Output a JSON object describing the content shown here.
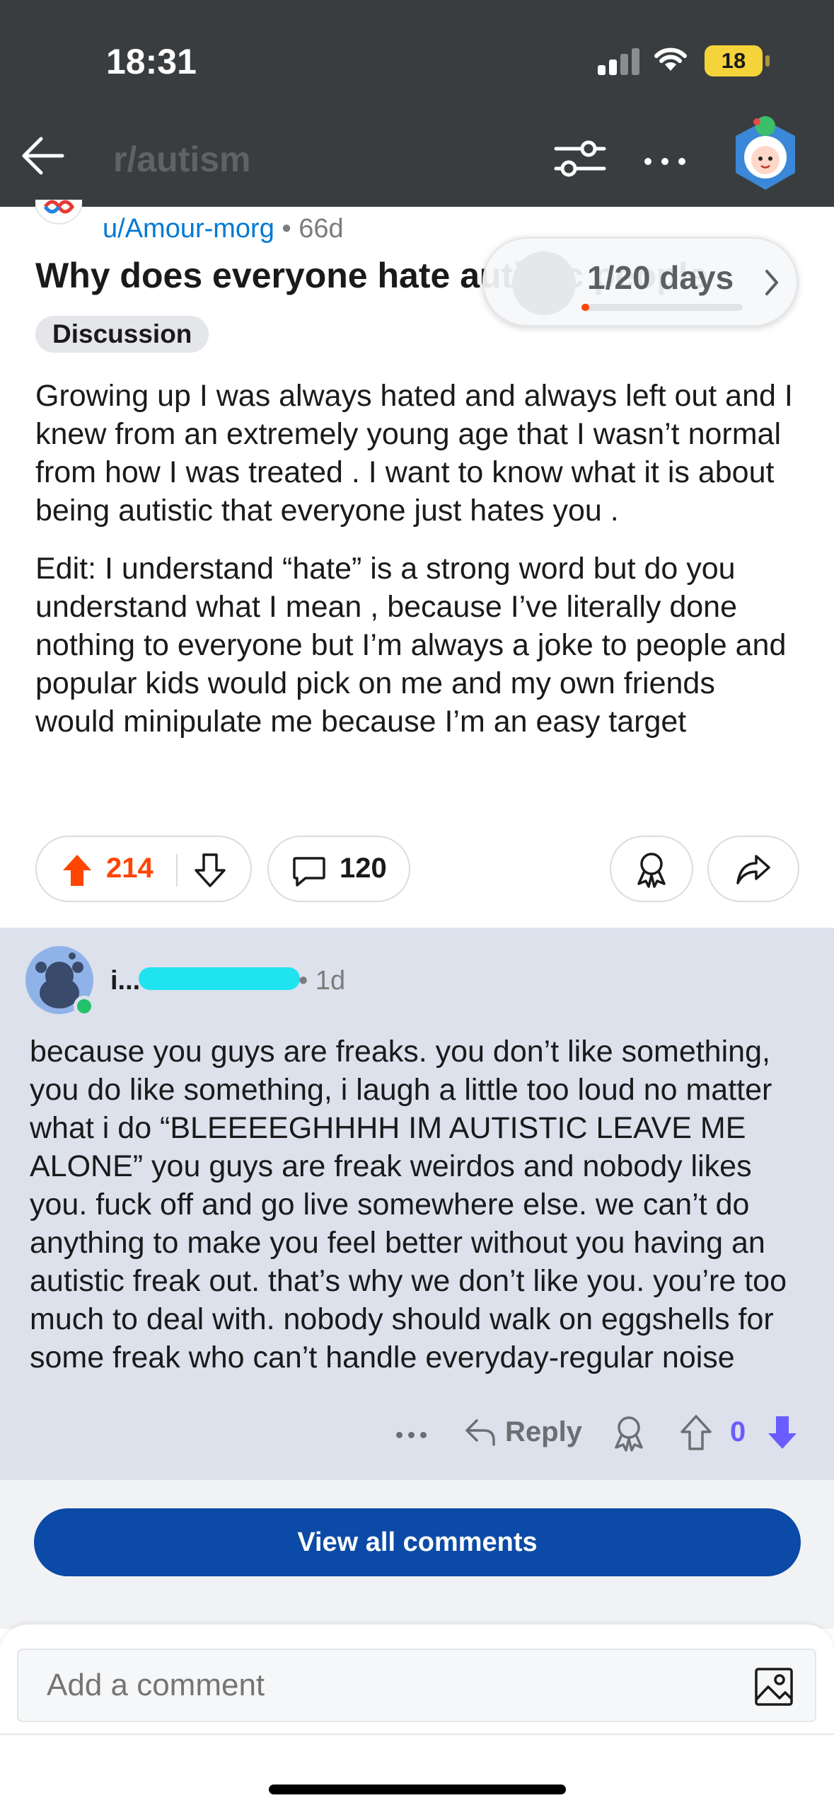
{
  "status_bar": {
    "time": "18:31",
    "battery": "18"
  },
  "nav": {
    "subreddit": "r/autism",
    "icons": [
      "back-arrow-icon",
      "filter-icon",
      "more-icon",
      "profile-avatar"
    ]
  },
  "post": {
    "author": "u/Amour-morg",
    "separator": "•",
    "age": "66d",
    "title": "Why does everyone hate autistic people",
    "flair": "Discussion",
    "body": [
      "Growing up I was always hated and always left out and I knew from an extremely young age that I wasn’t normal from how I was treated . I want to know what it is about being autistic that everyone just hates you .",
      "Edit: I understand “hate” is a strong word but do you understand what I mean , because I’ve literally done nothing to everyone but I’m always a joke to people and popular kids would pick on me and my own friends would minipulate me because I’m an easy target"
    ],
    "votes": "214",
    "comments": "120"
  },
  "streak": {
    "label": "1/20 days",
    "progress": 0.05
  },
  "comment": {
    "username": "i...",
    "separator": "•",
    "age": "1d",
    "body": "because you guys are freaks. you don’t like something, you do like something, i laugh a little too loud no matter what i do “BLEEEEGHHHH IM AUTISTIC LEAVE ME ALONE” you guys are freak weirdos and nobody likes you. fuck off and go live somewhere else. we can’t do anything to make you feel better without you having an autistic freak out. that’s why we don’t like you. you’re too much to deal with. nobody should walk on eggshells for some freak who can’t handle everyday-regular noise",
    "reply_label": "Reply",
    "score": "0"
  },
  "view_all_label": "View all comments",
  "composer": {
    "placeholder": "Add a comment"
  },
  "colors": {
    "upvote": "#ff4500",
    "downvote_active": "#6a5cff",
    "link": "#0079d3",
    "primary_button": "#0b4aa6",
    "comment_highlight": "#dce1ec"
  }
}
